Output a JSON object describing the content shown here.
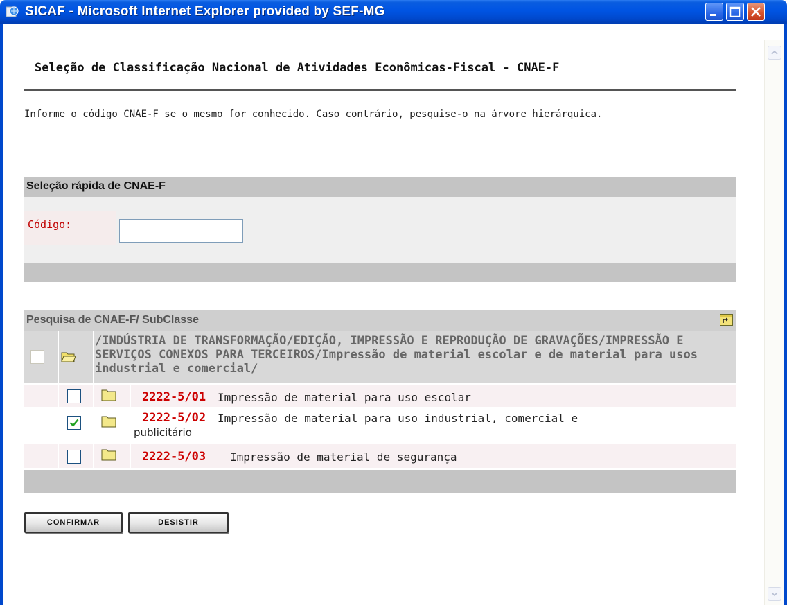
{
  "window": {
    "title": "SICAF - Microsoft Internet Explorer provided by SEF-MG",
    "controls": [
      "minimize",
      "maximize",
      "close"
    ]
  },
  "page": {
    "title": "Seleção de Classificação Nacional de Atividades Econômicas-Fiscal - CNAE-F",
    "intro": "Informe o código CNAE-F se o mesmo for conhecido. Caso contrário, pesquise-o na árvore hierárquica."
  },
  "quick_select": {
    "header": "Seleção rápida de CNAE-F",
    "code_label": "Código:",
    "code_value": ""
  },
  "search": {
    "header": "Pesquisa de CNAE-F/ SubClasse",
    "path": "/INDÚSTRIA DE TRANSFORMAÇÃO/EDIÇÃO, IMPRESSÃO E REPRODUÇÃO DE GRAVAÇÕES/IMPRESSÃO E SERVIÇOS CONEXOS PARA TERCEIROS/Impressão de material escolar e de material para usos industrial e comercial/",
    "items": [
      {
        "code": "2222-5/01",
        "description": "Impressão de material para uso escolar",
        "checked": false
      },
      {
        "code": "2222-5/02",
        "description": "Impressão de material para uso industrial, comercial e",
        "description_cont": "publicitário",
        "checked": true
      },
      {
        "code": "2222-5/03",
        "description": "Impressão de material de segurança",
        "checked": false
      }
    ]
  },
  "buttons": {
    "confirm": "CONFIRMAR",
    "cancel": "DESISTIR"
  },
  "colors": {
    "titlebar": "#0054e3",
    "code_red": "#cc0000",
    "section_gray": "#c4c4c4"
  }
}
